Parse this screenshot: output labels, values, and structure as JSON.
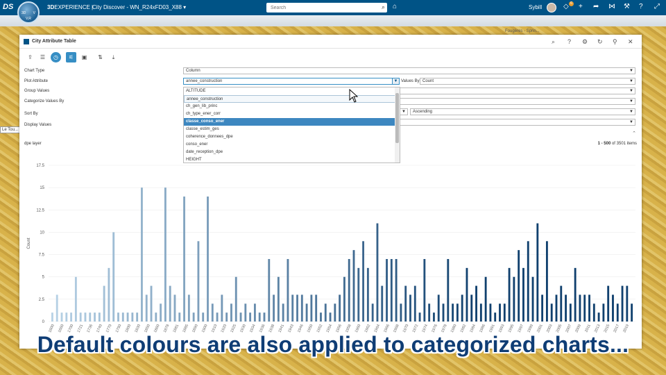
{
  "topbar": {
    "brand_bold": "3D",
    "brand_rest": "EXPERIENCE",
    "separator": "|",
    "app_title": "City Discover - WN_R24xFD03_X88",
    "app_chevron": "chevron-down-icon",
    "search_placeholder": "Search",
    "user_name": "Sybill",
    "notification_count": "6",
    "compass": {
      "left": "3D",
      "right": "V",
      "bottom": "V,R"
    },
    "logo": "DS"
  },
  "map": {
    "overlay_label": "Fougères - Sprin...",
    "left_label": "Le Tou..."
  },
  "panel": {
    "title": "City Attribute Table",
    "header_icons": [
      "search-icon",
      "help-icon",
      "gear-icon",
      "refresh-icon",
      "pin-icon",
      "close-icon"
    ],
    "toolbar_icons": [
      "export-icon",
      "list-icon",
      "clock-icon",
      "settings-sliders-icon",
      "screen-icon",
      "import-icon",
      "download-icon"
    ]
  },
  "form": {
    "chart_type_label": "Chart Type",
    "chart_type_value": "Column",
    "plot_attribute_label": "Plot Attribute",
    "plot_attribute_value": "annee_construction",
    "values_by_label": "Values By",
    "values_by_value": "Count",
    "group_values_label": "Group Values",
    "categorize_label": "Categorize Values By",
    "sort_by_label": "Sort By",
    "sort_by_value": "Ascending",
    "display_values_label": "Display Values"
  },
  "dropdown": {
    "items": [
      "ALTITUDE",
      "annee_construction",
      "ch_gen_lib_princ",
      "ch_type_ener_corr",
      "classe_conso_ener",
      "classe_estim_ges",
      "coherence_donnees_dpe",
      "conso_ener",
      "date_reception_dpe",
      "HEIGHT"
    ],
    "highlighted_index": 1,
    "selected_index": 4
  },
  "chart_header": {
    "layer_name": "dpe layer",
    "range": "1 - 500",
    "of_text": "of 3501 items"
  },
  "chart_data": {
    "type": "bar",
    "title": "",
    "xlabel": "annee_construction",
    "ylabel": "Count",
    "ylim": [
      0,
      17.5
    ],
    "yticks": [
      "0",
      "2.5",
      "5",
      "7.5",
      "10",
      "12.5",
      "15",
      "17.5"
    ],
    "grid": true,
    "color_start": "#b7d2e6",
    "color_end": "#10406e",
    "x_tick_labels": [
      "1600",
      "1660",
      "1700",
      "1721",
      "1736",
      "1740",
      "1770",
      "1790",
      "1800",
      "1830",
      "1850",
      "1860",
      "1878",
      "1881",
      "1885",
      "1890",
      "1900",
      "1910",
      "1920",
      "1925",
      "1930",
      "1934",
      "1936",
      "1938",
      "1941",
      "1943",
      "1946",
      "1950",
      "1952",
      "1954",
      "1956",
      "1958",
      "1960",
      "1962",
      "1964",
      "1966",
      "1968",
      "1970",
      "1972",
      "1974",
      "1976",
      "1978",
      "1980",
      "1982",
      "1984",
      "1986",
      "1991",
      "1993",
      "1995",
      "1997",
      "1999",
      "2001",
      "2003",
      "2005",
      "2007",
      "2009",
      "2011",
      "2013",
      "2015",
      "2017",
      "2019"
    ],
    "values": [
      1,
      3,
      1,
      1,
      1,
      5,
      1,
      1,
      1,
      1,
      1,
      4,
      6,
      10,
      1,
      1,
      1,
      1,
      1,
      15,
      3,
      4,
      1,
      2,
      15,
      4,
      3,
      1,
      14,
      3,
      1,
      9,
      1,
      14,
      2,
      1,
      3,
      1,
      2,
      5,
      1,
      2,
      1,
      2,
      1,
      1,
      7,
      3,
      5,
      2,
      7,
      3,
      3,
      3,
      2,
      3,
      3,
      1,
      2,
      1,
      2,
      3,
      5,
      7,
      8,
      6,
      9,
      6,
      2,
      11,
      4,
      7,
      7,
      7,
      2,
      4,
      3,
      4,
      1,
      7,
      2,
      1,
      3,
      2,
      7,
      2,
      2,
      3,
      6,
      3,
      4,
      2,
      5,
      2,
      1,
      2,
      2,
      6,
      5,
      8,
      6,
      9,
      5,
      11,
      3,
      9,
      2,
      3,
      4,
      3,
      2,
      6,
      3,
      3,
      3,
      2,
      1,
      2,
      4,
      3,
      2,
      4,
      4,
      2
    ]
  },
  "caption": "Default colours are also applied to categorized charts..."
}
